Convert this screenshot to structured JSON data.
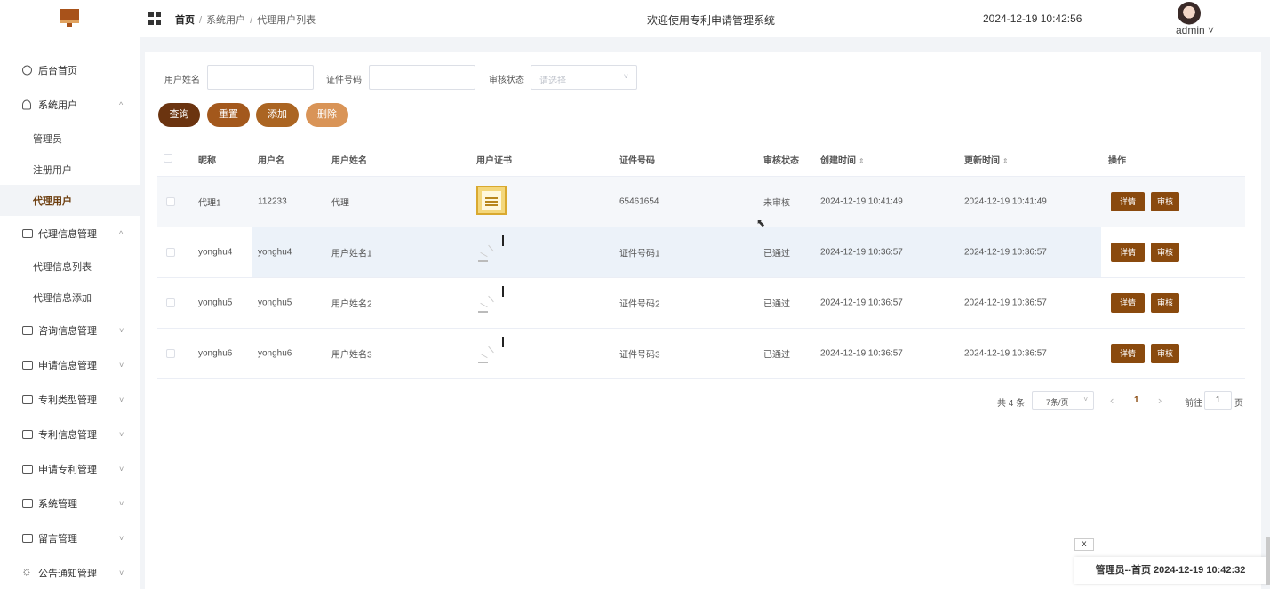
{
  "header": {
    "breadcrumb": [
      "首页",
      "系统用户",
      "代理用户列表"
    ],
    "welcome": "欢迎使用专利申请管理系统",
    "datetime": "2024-12-19 10:42:56",
    "user": "admin ˅"
  },
  "sidebar": {
    "items": [
      {
        "label": "后台首页",
        "icon": "dashboard-icon"
      },
      {
        "label": "系统用户",
        "icon": "user-icon",
        "expanded": true,
        "children": [
          "管理员",
          "注册用户",
          "代理用户"
        ],
        "active_child": "代理用户"
      },
      {
        "label": "代理信息管理",
        "icon": "folder-icon",
        "expanded": true,
        "children": [
          "代理信息列表",
          "代理信息添加"
        ]
      },
      {
        "label": "咨询信息管理",
        "icon": "folder-icon"
      },
      {
        "label": "申请信息管理",
        "icon": "folder-icon"
      },
      {
        "label": "专利类型管理",
        "icon": "folder-icon"
      },
      {
        "label": "专利信息管理",
        "icon": "folder-icon"
      },
      {
        "label": "申请专利管理",
        "icon": "folder-icon"
      },
      {
        "label": "系统管理",
        "icon": "folder-icon"
      },
      {
        "label": "留言管理",
        "icon": "folder-icon"
      },
      {
        "label": "公告通知管理",
        "icon": "sun-icon"
      }
    ],
    "arrow_up": "^",
    "arrow_down": "˅"
  },
  "search": {
    "name_label": "用户姓名",
    "name_value": "",
    "id_label": "证件号码",
    "id_value": "",
    "status_label": "审核状态",
    "status_placeholder": "请选择"
  },
  "buttons": {
    "query": "查询",
    "reset": "重置",
    "add": "添加",
    "delete": "删除"
  },
  "colors": {
    "query": "#6b3410",
    "reset": "#a3581c",
    "add": "#ab6522",
    "delete": "#d99457",
    "action": "#8a4a0e",
    "active_menu": "#6e3f10"
  },
  "table": {
    "headers": [
      "昵称",
      "用户名",
      "用户姓名",
      "用户证书",
      "证件号码",
      "审核状态",
      "创建时间",
      "更新时间",
      "操作"
    ],
    "sort_icon": "⇕",
    "rows": [
      {
        "nickname": "代理1",
        "username": "112233",
        "realname": "代理",
        "cert": "image",
        "id_no": "65461654",
        "status": "未审核",
        "created": "2024-12-19 10:41:49",
        "updated": "2024-12-19 10:41:49"
      },
      {
        "nickname": "yonghu4",
        "username": "yonghu4",
        "realname": "用户姓名1",
        "cert": "loading",
        "id_no": "证件号码1",
        "status": "已通过",
        "created": "2024-12-19 10:36:57",
        "updated": "2024-12-19 10:36:57"
      },
      {
        "nickname": "yonghu5",
        "username": "yonghu5",
        "realname": "用户姓名2",
        "cert": "loading",
        "id_no": "证件号码2",
        "status": "已通过",
        "created": "2024-12-19 10:36:57",
        "updated": "2024-12-19 10:36:57"
      },
      {
        "nickname": "yonghu6",
        "username": "yonghu6",
        "realname": "用户姓名3",
        "cert": "loading",
        "id_no": "证件号码3",
        "status": "已通过",
        "created": "2024-12-19 10:36:57",
        "updated": "2024-12-19 10:36:57"
      }
    ],
    "detail_label": "详情",
    "audit_label": "审核"
  },
  "pagination": {
    "total": "共 4 条",
    "page_size": "7条/页",
    "prev": "‹",
    "current": "1",
    "next": "›",
    "goto_label": "前往",
    "goto_value": "1",
    "page_suffix": "页"
  },
  "floating_tag": {
    "close": "x",
    "text": "管理员--首页 2024-12-19 10:42:32"
  }
}
